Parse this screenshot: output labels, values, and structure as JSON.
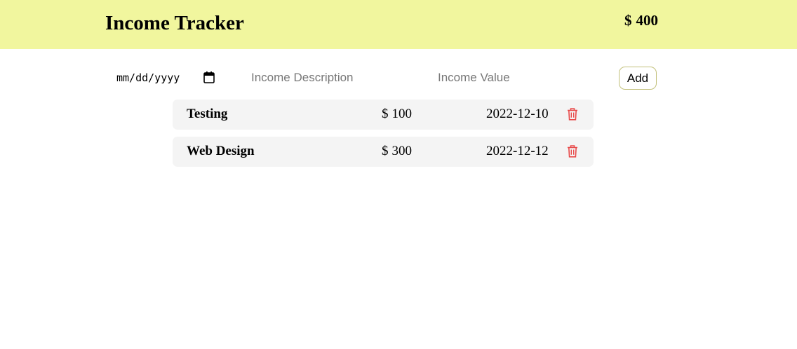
{
  "header": {
    "title": "Income Tracker",
    "currency": "$",
    "total": "400",
    "background_color": "#f1f69e"
  },
  "form": {
    "date_placeholder": "mm/dd/yyyy",
    "description_placeholder": "Income Description",
    "value_placeholder": "Income Value",
    "add_label": "Add"
  },
  "incomes": [
    {
      "description": "Testing",
      "currency": "$",
      "value": "100",
      "date": "2022-12-10"
    },
    {
      "description": "Web Design",
      "currency": "$",
      "value": "300",
      "date": "2022-12-12"
    }
  ],
  "icons": {
    "calendar": "calendar-icon",
    "delete": "trash-icon",
    "delete_color": "#e84a4a"
  }
}
